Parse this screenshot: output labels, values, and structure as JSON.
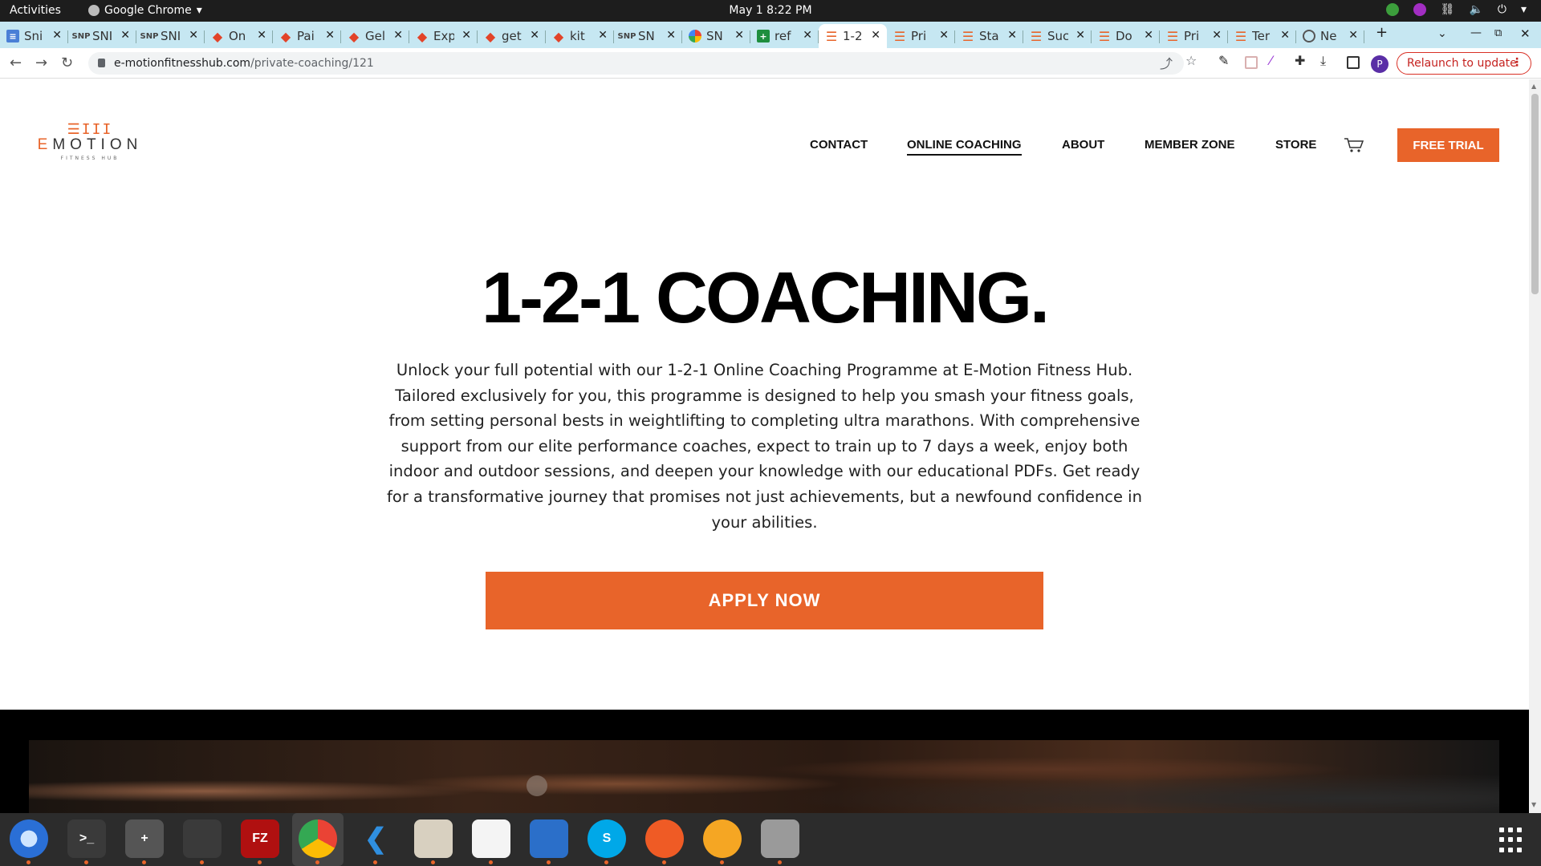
{
  "topbar": {
    "activities": "Activities",
    "app_name": "Google Chrome",
    "clock": "May 1  8:22 PM"
  },
  "tabs": [
    {
      "title": "Sni",
      "icon": "google-docs-icon"
    },
    {
      "title": "SNI",
      "icon": "snip-icon"
    },
    {
      "title": "SNI",
      "icon": "snip-icon"
    },
    {
      "title": "On",
      "icon": "gitlab-icon"
    },
    {
      "title": "Pai",
      "icon": "gitlab-icon"
    },
    {
      "title": "Gel",
      "icon": "gitlab-icon"
    },
    {
      "title": "Exp",
      "icon": "gitlab-icon"
    },
    {
      "title": "get",
      "icon": "gitlab-icon"
    },
    {
      "title": "kit",
      "icon": "gitlab-icon"
    },
    {
      "title": "SN",
      "icon": "snip-icon"
    },
    {
      "title": "SN",
      "icon": "google-icon"
    },
    {
      "title": "ref",
      "icon": "google-sheets-icon"
    },
    {
      "title": "1-2",
      "icon": "emotion-icon",
      "active": true
    },
    {
      "title": "Pri",
      "icon": "emotion-icon"
    },
    {
      "title": "Sta",
      "icon": "emotion-icon"
    },
    {
      "title": "Suc",
      "icon": "emotion-icon"
    },
    {
      "title": "Do",
      "icon": "emotion-icon"
    },
    {
      "title": "Pri",
      "icon": "emotion-icon"
    },
    {
      "title": "Ter",
      "icon": "emotion-icon"
    },
    {
      "title": "Ne",
      "icon": "chrome-new-tab-icon"
    }
  ],
  "toolbar": {
    "url_domain": "e-motionfitnesshub.com",
    "url_path": "/private-coaching/121",
    "avatar_letter": "P",
    "relaunch_label": "Relaunch to update"
  },
  "site": {
    "logo": {
      "marks": "☰III",
      "name_e": "E",
      "name_rest": "MOTION",
      "sub": "FITNESS HUB"
    },
    "nav": {
      "contact": "CONTACT",
      "online_coaching": "ONLINE COACHING",
      "about": "ABOUT",
      "member_zone": "MEMBER ZONE",
      "store": "STORE"
    },
    "free_trial": "FREE TRIAL",
    "hero_title": "1-2-1 COACHING.",
    "hero_text": "Unlock your full potential with our 1-2-1 Online Coaching Programme at E-Motion Fitness Hub. Tailored exclusively for you, this programme is designed to help you smash your fitness goals, from setting personal bests in weightlifting to completing ultra marathons. With comprehensive support from our elite performance coaches, expect to train up to 7 days a week, enjoy both indoor and outdoor sessions, and deepen your knowledge with our educational PDFs. Get ready for a transformative journey that promises not just achievements, but a newfound confidence in your abilities.",
    "apply_label": "APPLY NOW",
    "accent_color": "#e8642a"
  },
  "dock": [
    {
      "name": "thunderbird",
      "label": ""
    },
    {
      "name": "terminal",
      "label": ">_"
    },
    {
      "name": "calculator",
      "label": "+"
    },
    {
      "name": "system-monitor",
      "label": ""
    },
    {
      "name": "filezilla",
      "label": "FZ"
    },
    {
      "name": "chrome",
      "label": ""
    },
    {
      "name": "vscode",
      "label": ""
    },
    {
      "name": "files",
      "label": ""
    },
    {
      "name": "text-editor",
      "label": ""
    },
    {
      "name": "libreoffice-writer",
      "label": ""
    },
    {
      "name": "skype",
      "label": "S"
    },
    {
      "name": "postman",
      "label": ""
    },
    {
      "name": "hotspot",
      "label": ""
    },
    {
      "name": "disk",
      "label": ""
    }
  ]
}
